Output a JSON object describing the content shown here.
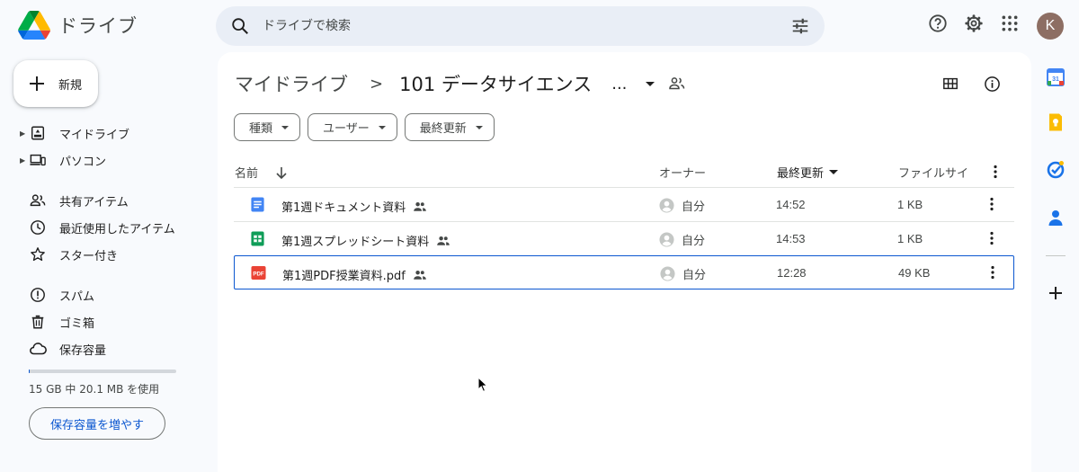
{
  "app": {
    "name": "ドライブ"
  },
  "search": {
    "placeholder": "ドライブで検索"
  },
  "account": {
    "initial": "K",
    "avatar_color": "#8d6e63"
  },
  "sidebar": {
    "new_label": "新規",
    "items": [
      {
        "label": "マイドライブ",
        "icon": "my-drive-icon"
      },
      {
        "label": "パソコン",
        "icon": "computer-icon"
      },
      {
        "label": "共有アイテム",
        "icon": "shared-icon"
      },
      {
        "label": "最近使用したアイテム",
        "icon": "clock-icon"
      },
      {
        "label": "スター付き",
        "icon": "star-icon"
      },
      {
        "label": "スパム",
        "icon": "spam-icon"
      },
      {
        "label": "ゴミ箱",
        "icon": "trash-icon"
      },
      {
        "label": "保存容量",
        "icon": "cloud-icon"
      }
    ],
    "storage_text": "15 GB 中 20.1 MB を使用",
    "storage_fraction": 0.0013,
    "more_storage_label": "保存容量を増やす"
  },
  "breadcrumb": {
    "root": "マイドライブ",
    "separator": ">",
    "current": "101 データサイエンス",
    "ellipsis": "..."
  },
  "filters": [
    "種類",
    "ユーザー",
    "最終更新"
  ],
  "table": {
    "headers": {
      "name": "名前",
      "owner": "オーナー",
      "modified": "最終更新",
      "size": "ファイルサイ"
    },
    "rows": [
      {
        "name": "第1週ドキュメント資料",
        "type": "docs",
        "owner": "自分",
        "modified": "14:52",
        "size": "1 KB",
        "selected": false
      },
      {
        "name": "第1週スプレッドシート資料",
        "type": "sheets",
        "owner": "自分",
        "modified": "14:53",
        "size": "1 KB",
        "selected": false
      },
      {
        "name": "第1週PDF授業資料.pdf",
        "type": "pdf",
        "owner": "自分",
        "modified": "12:28",
        "size": "49 KB",
        "selected": true
      }
    ]
  },
  "colors": {
    "accent": "#0b57d0",
    "docs": "#4285f4",
    "sheets": "#0f9d58",
    "pdf": "#ea4335",
    "background": "#f8fafd",
    "search_bg": "#e9eef6"
  },
  "side_panel": [
    "calendar-icon",
    "keep-icon",
    "tasks-icon",
    "contacts-icon",
    "add-icon"
  ]
}
